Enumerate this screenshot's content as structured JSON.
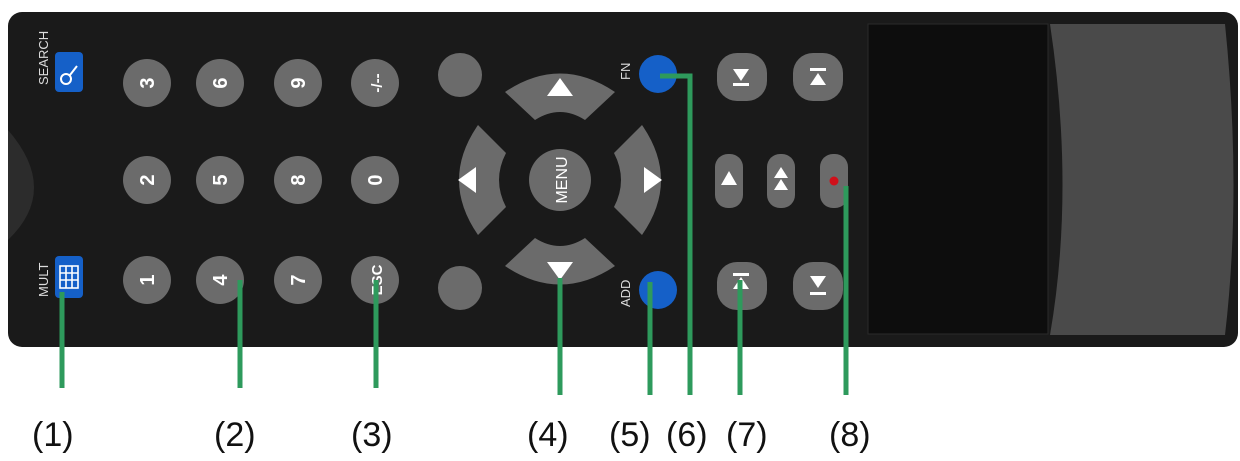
{
  "side_labels": {
    "search": "SEARCH",
    "mult": "MULT",
    "fn": "FN",
    "add": "ADD"
  },
  "digit_buttons": {
    "row_top": [
      "3",
      "6",
      "9",
      "-/--"
    ],
    "row_mid": [
      "2",
      "5",
      "8",
      "0"
    ],
    "row_bot": [
      "1",
      "4",
      "7",
      "ESC"
    ]
  },
  "center_label": "MENU",
  "callouts": [
    "(1)",
    "(2)",
    "(3)",
    "(4)",
    "(5)",
    "(6)",
    "(7)",
    "(8)"
  ],
  "colors": {
    "body": "#1a1a1a",
    "button": "#6b6b6b",
    "blue_button": "#1560c8",
    "record_dot": "#d0101a",
    "callout_line": "#2e9a5c"
  },
  "icons": {
    "search": "magnifier-icon",
    "mult": "grid-icon",
    "transport": [
      "step-forward-icon",
      "skip-end-icon",
      "play-icon",
      "fast-play-icon",
      "record-icon",
      "step-back-icon",
      "skip-start-icon"
    ]
  }
}
